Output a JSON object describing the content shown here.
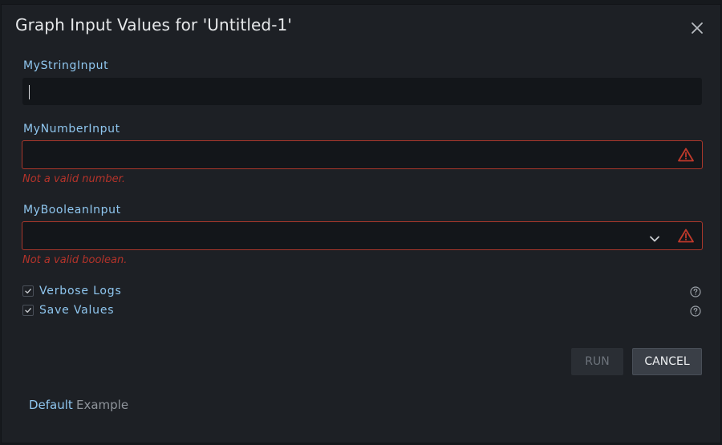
{
  "dialog": {
    "title": "Graph Input Values for 'Untitled-1'"
  },
  "fields": {
    "string_input": {
      "label": "MyStringInput",
      "value": ""
    },
    "number_input": {
      "label": "MyNumberInput",
      "value": "",
      "error": "Not a valid number."
    },
    "boolean_input": {
      "label": "MyBooleanInput",
      "value": "",
      "error": "Not a valid boolean."
    }
  },
  "options": {
    "verbose_logs": {
      "label": "Verbose Logs",
      "checked": true
    },
    "save_values": {
      "label": "Save Values",
      "checked": true
    }
  },
  "buttons": {
    "run": "RUN",
    "cancel": "CANCEL"
  },
  "tabs": [
    {
      "label": "Default",
      "active": true
    },
    {
      "label": "Example",
      "active": false
    }
  ],
  "colors": {
    "accent": "#8fc6ef",
    "error": "#b3332a"
  }
}
